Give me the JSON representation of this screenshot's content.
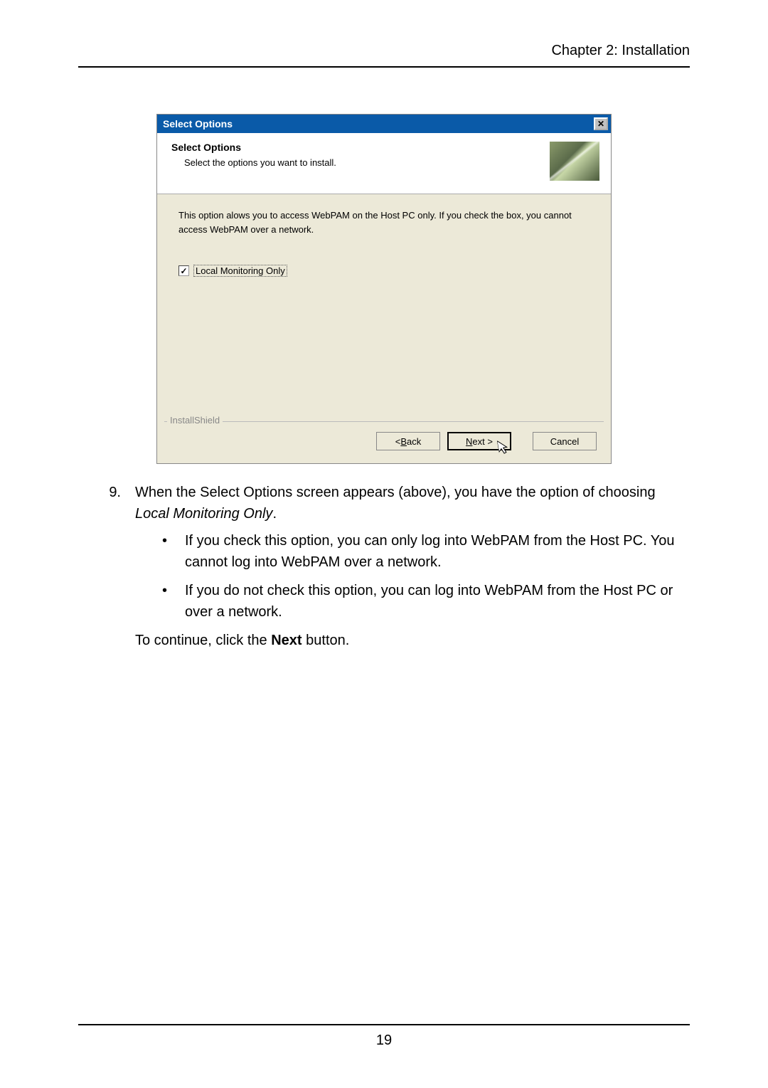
{
  "header": {
    "chapter": "Chapter 2: Installation"
  },
  "dialog": {
    "title": "Select Options",
    "close_symbol": "✕",
    "heading": "Select Options",
    "subheading": "Select the options you want to install.",
    "description": "This option alows you to access WebPAM on the Host PC only. If you check the box, you cannot access WebPAM over a network.",
    "checkbox_mark": "✓",
    "checkbox_label": "Local Monitoring Only",
    "fieldset": "InstallShield",
    "buttons": {
      "back_prefix": "< ",
      "back_u": "B",
      "back_suffix": "ack",
      "next_u": "N",
      "next_suffix": "ext >",
      "cancel": "Cancel"
    },
    "cursor": "↖"
  },
  "instructions": {
    "number": "9.",
    "main_text_1": "When the Select Options screen appears (above), you have the option of choosing ",
    "main_text_italic": "Local Monitoring Only",
    "main_text_2": ".",
    "bullet_mark": "•",
    "bullet1": "If you check this option, you can only log into WebPAM from the Host PC. You cannot log into WebPAM over a network.",
    "bullet2": "If you do not check this option, you can log into WebPAM from the Host PC or over a network.",
    "continue_1": "To continue, click the ",
    "continue_bold": "Next",
    "continue_2": " button."
  },
  "footer": {
    "page_number": "19"
  }
}
